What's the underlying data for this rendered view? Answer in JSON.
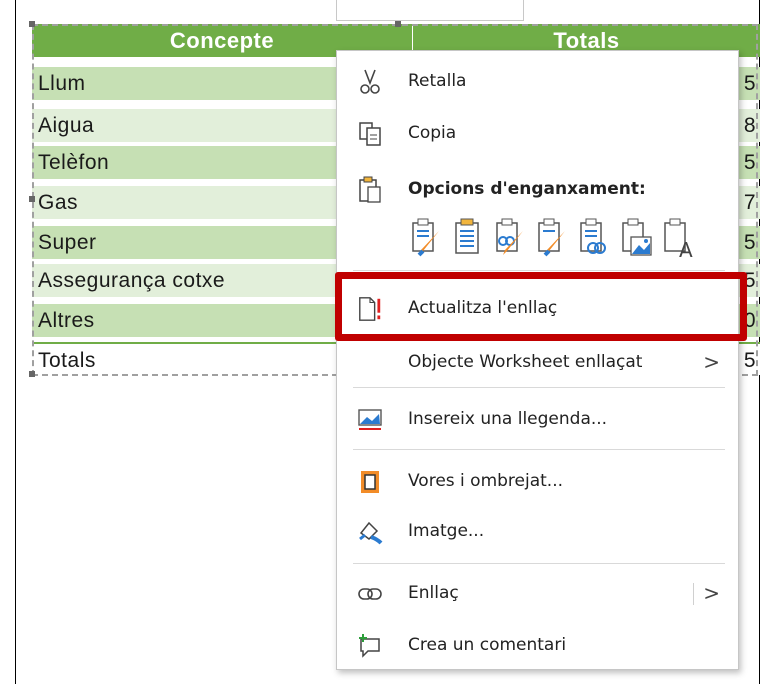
{
  "table": {
    "headers": [
      "Concepte",
      "Totals"
    ],
    "rows": [
      {
        "label": "Llum",
        "value": "5"
      },
      {
        "label": "Aigua",
        "value": "8"
      },
      {
        "label": "Telèfon",
        "value": "5"
      },
      {
        "label": "Gas",
        "value": "7"
      },
      {
        "label": "Super",
        "value": "5"
      },
      {
        "label": "Assegurança cotxe",
        "value": "5"
      },
      {
        "label": "Altres",
        "value": "0"
      },
      {
        "label": "Totals",
        "value": "5"
      }
    ]
  },
  "menu": {
    "cut": {
      "label": "Retalla",
      "icon": "scissors-icon"
    },
    "copy": {
      "label": "Copia",
      "icon": "copy-icon"
    },
    "paste_options": {
      "label": "Opcions d'enganxament:",
      "icon": "clipboard-icon"
    },
    "paste_buttons": [
      "keep-source-formatting",
      "use-destination-styles",
      "link-keep-source",
      "link-use-destination",
      "embed-picture",
      "keep-text-only"
    ],
    "update_link": {
      "label": "Actualitza l'enllaç",
      "icon": "update-link-icon"
    },
    "linked_object": {
      "label": "Objecte Worksheet enllaçat",
      "arrow": ">"
    },
    "insert_caption": {
      "label": "Insereix una llegenda...",
      "icon": "caption-icon"
    },
    "borders": {
      "label": "Vores i ombrejat...",
      "icon": "borders-shading-icon"
    },
    "picture": {
      "label": "Imatge...",
      "icon": "format-picture-icon"
    },
    "link": {
      "label": "Enllaç",
      "icon": "link-icon",
      "arrow": ">"
    },
    "comment": {
      "label": "Crea un comentari",
      "icon": "new-comment-icon"
    }
  },
  "colors": {
    "header_green": "#70ad47",
    "band_dark": "#c6e0b4",
    "band_light": "#e2efda",
    "highlight": "#c00000",
    "icon_orange": "#f28c28",
    "icon_blue": "#2b7bd0"
  }
}
